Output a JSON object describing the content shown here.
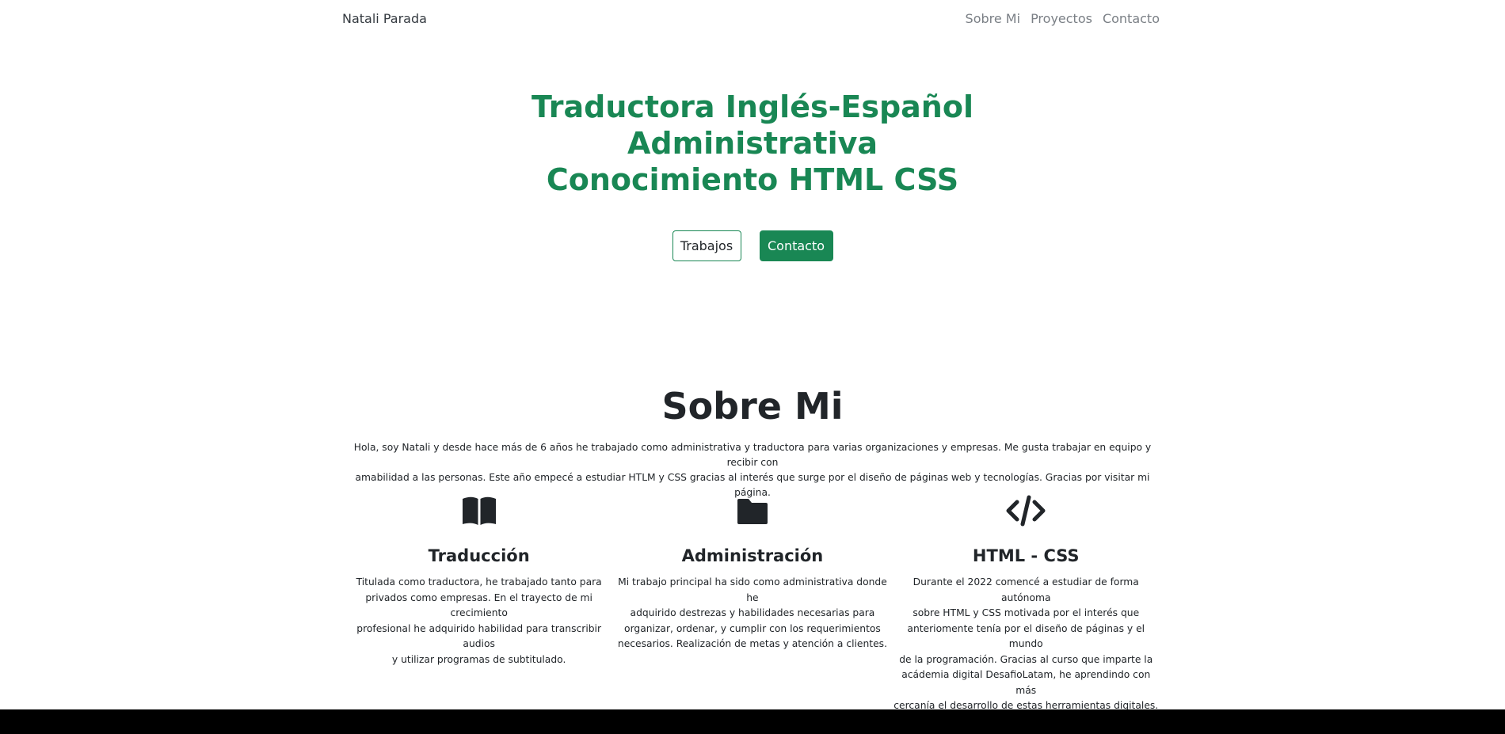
{
  "navbar": {
    "brand": "Natali Parada",
    "links": [
      "Sobre Mi",
      "Proyectos",
      "Contacto"
    ]
  },
  "hero": {
    "line1": "Traductora Inglés-Español",
    "line2": "Administrativa",
    "line3": "Conocimiento HTML CSS",
    "btn_works": "Trabajos",
    "btn_contact": "Contacto"
  },
  "about": {
    "title": "Sobre Mi",
    "text_line1": "Hola, soy Natali y desde hace más de 6 años he trabajado como administrativa y traductora para varias organizaciones y empresas. Me gusta trabajar en equipo y recibir con",
    "text_line2": "amabilidad a las personas. Este año empecé a estudiar HTLM y CSS gracias al interés que surge por el diseño de páginas web y tecnologías. Gracias por visitar mi página."
  },
  "features": [
    {
      "icon": "book-open-icon",
      "title": "Traducción",
      "lines": [
        "Titulada como traductora, he trabajado tanto para",
        "privados como empresas. En el trayecto de mi crecimiento",
        "profesional he adquirido habilidad para transcribir audios",
        "y utilizar programas de subtitulado."
      ]
    },
    {
      "icon": "folder-icon",
      "title": "Administración",
      "lines": [
        "Mi trabajo principal ha sido como administrativa donde he",
        "adquirido destrezas y habilidades necesarias para",
        "organizar, ordenar, y cumplir con los requerimientos",
        "necesarios. Realización de metas y atención a clientes."
      ]
    },
    {
      "icon": "code-icon",
      "title": "HTML - CSS",
      "lines": [
        "Durante el 2022 comencé a estudiar de forma autónoma",
        "sobre HTML y CSS motivada por el interés que",
        "anteriomente tenía por el diseño de páginas y el mundo",
        "de la programación. Gracias al curso que imparte la",
        "acádemia digital DesafioLatam, he aprendindo con más",
        "cercanía el desarrollo de estas herramientas digitales."
      ]
    }
  ],
  "colors": {
    "accent": "#198754",
    "text": "#212529",
    "footer": "#000000"
  }
}
